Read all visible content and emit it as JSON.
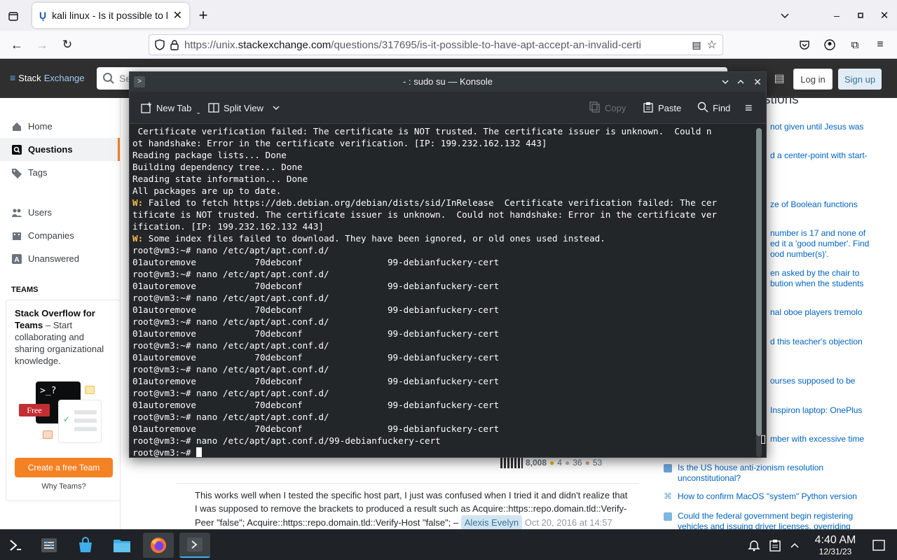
{
  "browser": {
    "tab_title": "kali linux - Is it possible to have apt accept an invalid certificate?",
    "url_prefix": "https://unix.",
    "url_domain": "stackexchange.com",
    "url_path": "/questions/317695/is-it-possible-to-have-apt-accept-an-invalid-certi"
  },
  "se": {
    "logo_stack": "Stack",
    "logo_exchange": "Exchange",
    "search_placeholder": "Se",
    "login_label": "Log in",
    "signup_label": "Sign up"
  },
  "sidebar": {
    "items": [
      {
        "label": "Home",
        "icon": "home-icon"
      },
      {
        "label": "Questions",
        "icon": "questions-icon"
      },
      {
        "label": "Tags",
        "icon": "tag-icon"
      },
      {
        "label": "Users",
        "icon": "users-icon"
      },
      {
        "label": "Companies",
        "icon": "companies-icon"
      },
      {
        "label": "Unanswered",
        "icon": "unanswered-icon"
      }
    ],
    "teams_heading": "TEAMS",
    "teams_title": "Stack Overflow for Teams",
    "teams_text": " – Start collaborating and sharing organizational knowledge.",
    "free_badge": "Free",
    "terminal_prompt": ">_?",
    "create_team_label": "Create a free Team",
    "why_teams_label": "Why Teams?"
  },
  "content": {
    "user_rep": "8,008",
    "gold": "4",
    "silver": "36",
    "bronze": "53",
    "comment_text": "This works well when I tested the specific host part, I just was confused when I tried it and didn't realize that I was supposed to remove the brackets to produced a result such as Acquire::https::repo.domain.tld::Verify-Peer \"false\"; Acquire::https::repo.domain.tld::Verify-Host \"false\"; –",
    "comment_user": "Alexis Evelyn",
    "comment_date": "Oct 20, 2016 at 14:57"
  },
  "right": {
    "heading": "stions",
    "hot": [
      "not given until Jesus was",
      "d a center-point with start-",
      "ze of Boolean functions",
      "number is 17 and none of\ned it a 'good number'. Find\nood number(s)'.",
      "en asked by the chair to\nbution when the students",
      "nal oboe players tremolo",
      "d this teacher's objection",
      "ourses supposed to be",
      "Inspiron laptop: OnePlus",
      "mber with excessive time",
      "Is the US house anti-zionism resolution unconstitutional?",
      "How to confirm MacOS \"system\" Python version",
      "Could the federal government begin registering vehicles and issuing driver licenses, overriding"
    ]
  },
  "konsole": {
    "title": "- : sudo su — Konsole",
    "new_tab": "New Tab",
    "split_view": "Split View",
    "copy": "Copy",
    "paste": "Paste",
    "find": "Find",
    "lines": [
      {
        "w": "",
        "t": " Certificate verification failed: The certificate is NOT trusted. The certificate issuer is unknown.  Could n"
      },
      {
        "w": "",
        "t": "ot handshake: Error in the certificate verification. [IP: 199.232.162.132 443]"
      },
      {
        "w": "",
        "t": "Reading package lists... Done"
      },
      {
        "w": "",
        "t": "Building dependency tree... Done"
      },
      {
        "w": "",
        "t": "Reading state information... Done"
      },
      {
        "w": "",
        "t": "All packages are up to date."
      },
      {
        "w": "W:",
        "t": " Failed to fetch https://deb.debian.org/debian/dists/sid/InRelease  Certificate verification failed: The cer"
      },
      {
        "w": "",
        "t": "tificate is NOT trusted. The certificate issuer is unknown.  Could not handshake: Error in the certificate ver"
      },
      {
        "w": "",
        "t": "ification. [IP: 199.232.162.132 443]"
      },
      {
        "w": "W:",
        "t": " Some index files failed to download. They have been ignored, or old ones used instead."
      },
      {
        "w": "",
        "t": "root@vm3:~# nano /etc/apt/apt.conf.d/"
      },
      {
        "w": "",
        "t": "01autoremove           70debconf                99-debianfuckery-cert"
      },
      {
        "w": "",
        "t": "root@vm3:~# nano /etc/apt/apt.conf.d/"
      },
      {
        "w": "",
        "t": "01autoremove           70debconf                99-debianfuckery-cert"
      },
      {
        "w": "",
        "t": "root@vm3:~# nano /etc/apt/apt.conf.d/"
      },
      {
        "w": "",
        "t": "01autoremove           70debconf                99-debianfuckery-cert"
      },
      {
        "w": "",
        "t": "root@vm3:~# nano /etc/apt/apt.conf.d/"
      },
      {
        "w": "",
        "t": "01autoremove           70debconf                99-debianfuckery-cert"
      },
      {
        "w": "",
        "t": "root@vm3:~# nano /etc/apt/apt.conf.d/"
      },
      {
        "w": "",
        "t": "01autoremove           70debconf                99-debianfuckery-cert"
      },
      {
        "w": "",
        "t": "root@vm3:~# nano /etc/apt/apt.conf.d/"
      },
      {
        "w": "",
        "t": "01autoremove           70debconf                99-debianfuckery-cert"
      },
      {
        "w": "",
        "t": "root@vm3:~# nano /etc/apt/apt.conf.d/"
      },
      {
        "w": "",
        "t": "01autoremove           70debconf                99-debianfuckery-cert"
      },
      {
        "w": "",
        "t": "root@vm3:~# nano /etc/apt/apt.conf.d/"
      },
      {
        "w": "",
        "t": "01autoremove           70debconf                99-debianfuckery-cert"
      },
      {
        "w": "",
        "t": "root@vm3:~# nano /etc/apt/apt.conf.d/99-debianfuckery-cert"
      },
      {
        "w": "",
        "t": "root@vm3:~# "
      }
    ]
  },
  "taskbar": {
    "time": "4:40 AM",
    "date": "12/31/23"
  }
}
